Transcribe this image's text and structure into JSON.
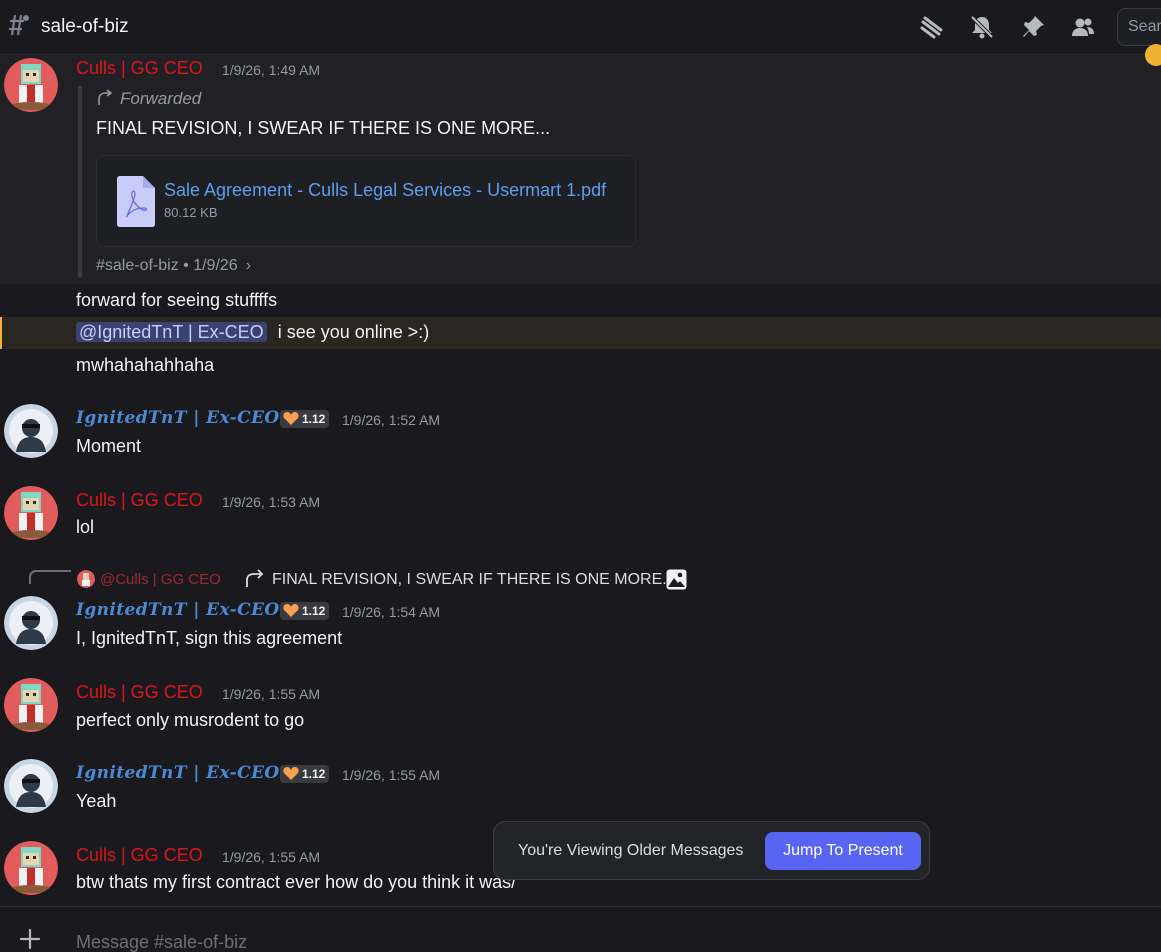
{
  "header": {
    "channel_name": "sale-of-biz",
    "search_placeholder": "Search",
    "icons": [
      "threads-icon",
      "mute-notifications-icon",
      "pin-icon",
      "members-icon"
    ]
  },
  "messages": [
    {
      "author": "Culls | GG CEO",
      "timestamp": "1/9/26, 1:49 AM",
      "forwarded_label": "Forwarded",
      "forwarded_text": "FINAL REVISION, I SWEAR IF THERE IS ONE MORE...",
      "attachment": {
        "name": "Sale Agreement - Culls Legal Services - Usermart 1.pdf",
        "size": "80.12 KB"
      },
      "source": "#sale-of-biz • 1/9/26"
    },
    {
      "text": "forward for seeing stuffffs"
    },
    {
      "mention": "@IgnitedTnT | Ex-CEO",
      "text": "i see you online >:)"
    },
    {
      "text": "mwhahahahhaha"
    },
    {
      "author": "IgnitedTnT | Ex-CEO",
      "badge": "1.12",
      "timestamp": "1/9/26, 1:52 AM",
      "text": "Moment"
    },
    {
      "author": "Culls | GG CEO",
      "timestamp": "1/9/26, 1:53 AM",
      "text": "lol"
    },
    {
      "reply_to": {
        "author": "@Culls | GG CEO",
        "text": "FINAL REVISION, I SWEAR IF THERE IS ONE MORE..."
      },
      "author": "IgnitedTnT | Ex-CEO",
      "badge": "1.12",
      "timestamp": "1/9/26, 1:54 AM",
      "text": "I, IgnitedTnT, sign this agreement"
    },
    {
      "author": "Culls | GG CEO",
      "timestamp": "1/9/26, 1:55 AM",
      "text": "perfect only musrodent to go"
    },
    {
      "author": "IgnitedTnT | Ex-CEO",
      "badge": "1.12",
      "timestamp": "1/9/26, 1:55 AM",
      "text": "Yeah"
    },
    {
      "author": "Culls | GG CEO",
      "timestamp": "1/9/26, 1:55 AM",
      "text": "btw thats my first contract ever how do you think it was/"
    }
  ],
  "banner": {
    "text": "You're Viewing Older Messages",
    "button": "Jump To Present"
  },
  "composer": {
    "placeholder": "Message #sale-of-biz"
  },
  "colors": {
    "culls_name": "#e0131d",
    "ignited_name": "#4b8bd6",
    "accent": "#5865f2",
    "mention_bg": "#3c4270"
  }
}
